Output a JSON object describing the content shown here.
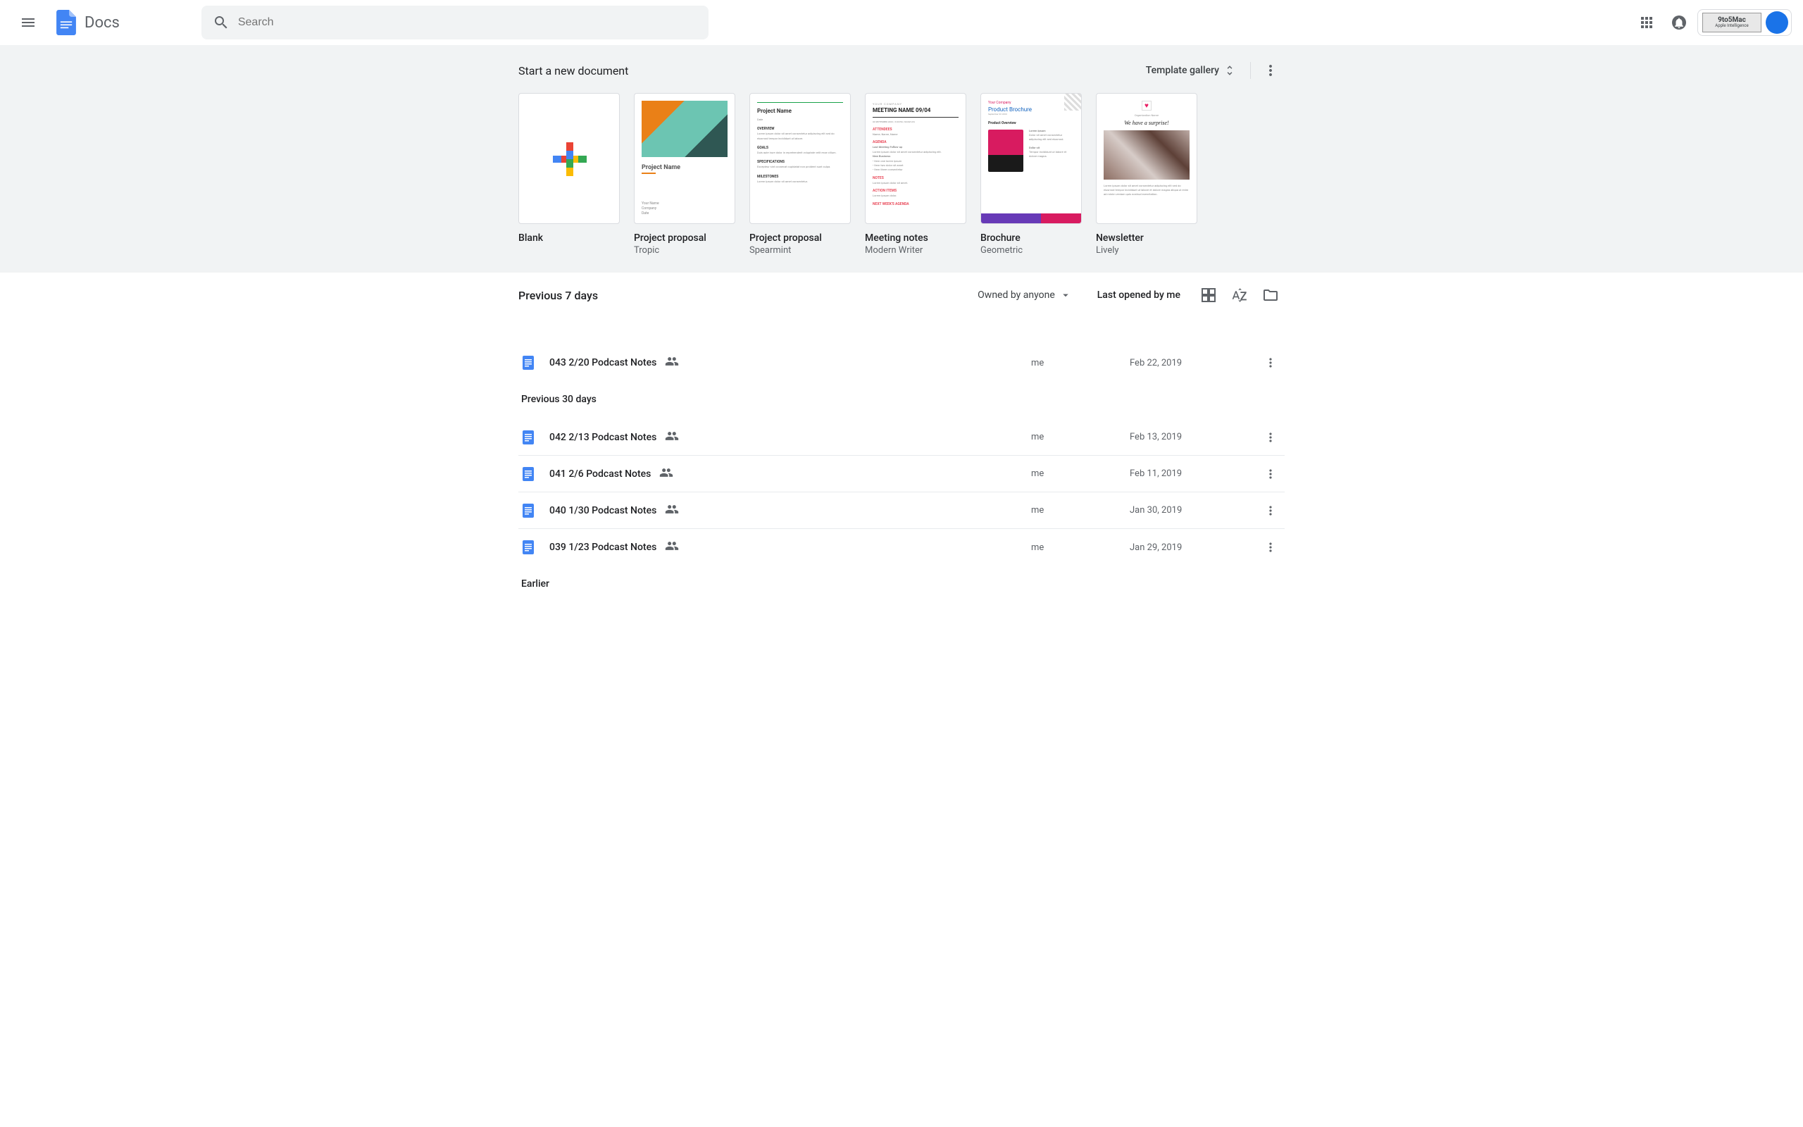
{
  "header": {
    "app_name": "Docs",
    "search_placeholder": "Search",
    "brand_name": "9to5Mac",
    "brand_sub": "Apple Intelligence"
  },
  "templates": {
    "section_title": "Start a new document",
    "gallery_label": "Template gallery",
    "items": [
      {
        "name": "Blank",
        "sub": ""
      },
      {
        "name": "Project proposal",
        "sub": "Tropic"
      },
      {
        "name": "Project proposal",
        "sub": "Spearmint"
      },
      {
        "name": "Meeting notes",
        "sub": "Modern Writer"
      },
      {
        "name": "Brochure",
        "sub": "Geometric"
      },
      {
        "name": "Newsletter",
        "sub": "Lively"
      }
    ],
    "thumb_text": {
      "tropic_pn": "Project Name",
      "spear_pn": "Project Name",
      "meeting_co": "YOUR COMPANY",
      "meeting_mn": "MEETING NAME 09/04",
      "brochure_yc": "Your Company",
      "brochure_pb": "Product Brochure",
      "brochure_ov": "Product Overview",
      "news_hl": "We have a surprise!"
    }
  },
  "docs": {
    "owner_filter": "Owned by anyone",
    "sort_label": "Last opened by me",
    "sections": [
      {
        "label": "Previous 7 days",
        "rows": [
          {
            "name": "043 2/20 Podcast Notes",
            "owner": "me",
            "date": "Feb 22, 2019",
            "shared": true
          }
        ]
      },
      {
        "label": "Previous 30 days",
        "rows": [
          {
            "name": "042 2/13 Podcast Notes",
            "owner": "me",
            "date": "Feb 13, 2019",
            "shared": true
          },
          {
            "name": "041 2/6 Podcast Notes",
            "owner": "me",
            "date": "Feb 11, 2019",
            "shared": true
          },
          {
            "name": "040 1/30 Podcast Notes",
            "owner": "me",
            "date": "Jan 30, 2019",
            "shared": true
          },
          {
            "name": "039 1/23 Podcast Notes",
            "owner": "me",
            "date": "Jan 29, 2019",
            "shared": true
          }
        ]
      },
      {
        "label": "Earlier",
        "rows": []
      }
    ]
  },
  "icons": {
    "menu": "hamburger-icon",
    "search": "search-icon",
    "apps": "apps-grid-icon",
    "notifications": "bell-icon",
    "unfold": "unfold-icon",
    "more": "more-vert-icon",
    "dropdown": "dropdown-icon",
    "grid": "grid-view-icon",
    "sort": "sort-az-icon",
    "folder": "folder-icon",
    "doc": "doc-icon",
    "shared": "shared-icon"
  },
  "colors": {
    "docs_blue": "#4285f4",
    "text_primary": "#202124",
    "text_secondary": "#5f6368",
    "surface_gray": "#f1f3f4"
  }
}
